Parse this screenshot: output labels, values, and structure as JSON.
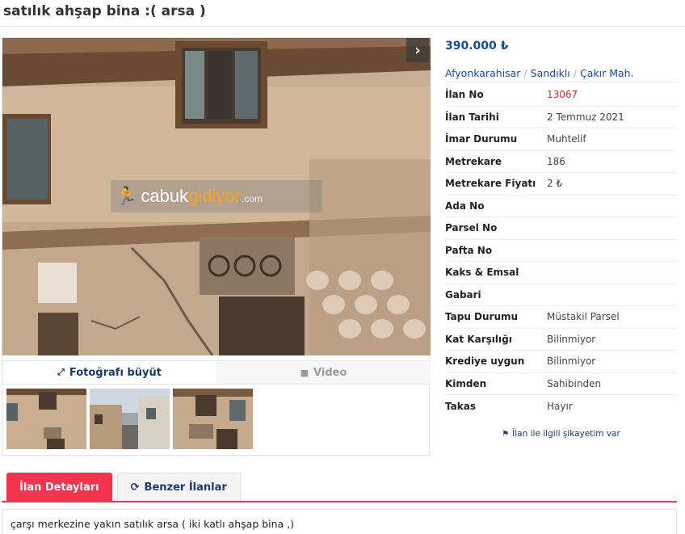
{
  "page": {
    "title": "satılık ahşap bina :( arsa )"
  },
  "gallery": {
    "next_icon": "chevron-right-icon",
    "watermark_brand_a": "cabuk",
    "watermark_brand_b": "gidiyor",
    "watermark_tld": ".com",
    "tab_enlarge": "Fotoğrafı büyüt",
    "tab_video": "Video",
    "thumbnail_count": 3
  },
  "listing": {
    "price": "390.000 ₺",
    "breadcrumb": [
      "Afyonkarahisar",
      "Sandıklı",
      "Çakır Mah."
    ],
    "details": [
      {
        "key": "İlan No",
        "value": "13067",
        "highlight": true
      },
      {
        "key": "İlan Tarihi",
        "value": "2 Temmuz 2021"
      },
      {
        "key": "İmar Durumu",
        "value": "Muhtelif"
      },
      {
        "key": "Metrekare",
        "value": "186"
      },
      {
        "key": "Metrekare Fiyatı",
        "value": "2 ₺"
      },
      {
        "key": "Ada No",
        "value": ""
      },
      {
        "key": "Parsel No",
        "value": ""
      },
      {
        "key": "Pafta No",
        "value": ""
      },
      {
        "key": "Kaks & Emsal",
        "value": ""
      },
      {
        "key": "Gabari",
        "value": ""
      },
      {
        "key": "Tapu Durumu",
        "value": "Müstakil Parsel"
      },
      {
        "key": "Kat Karşılığı",
        "value": "Bilinmiyor"
      },
      {
        "key": "Krediye uygun",
        "value": "Bilinmiyor"
      },
      {
        "key": "Kimden",
        "value": "Sahibinden"
      },
      {
        "key": "Takas",
        "value": "Hayır"
      }
    ],
    "complaint_link": "İlan ile ilgili şikayetim var"
  },
  "bottom_tabs": {
    "details": "İlan Detayları",
    "similar": "Benzer İlanlar"
  },
  "description": {
    "text": "çarşı merkezine yakın satılık arsa ( iki katlı ahşap bina ,)"
  },
  "colors": {
    "accent": "#f5334f",
    "link": "#1a4a9a",
    "highlight": "#d0262c"
  }
}
